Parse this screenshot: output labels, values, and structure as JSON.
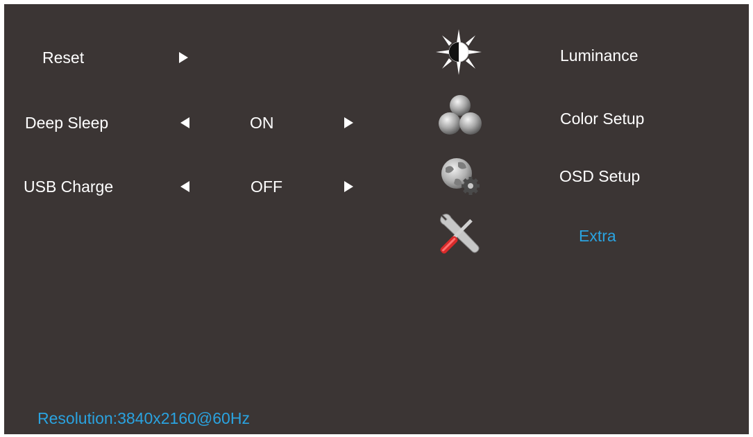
{
  "settings": {
    "rows": [
      {
        "label": "Reset"
      },
      {
        "label": "Deep Sleep",
        "value": "ON"
      },
      {
        "label": "USB Charge",
        "value": "OFF"
      }
    ]
  },
  "menu": {
    "items": [
      {
        "label": "Luminance",
        "icon": "sun-contrast-icon"
      },
      {
        "label": "Color Setup",
        "icon": "color-balls-icon"
      },
      {
        "label": "OSD Setup",
        "icon": "globe-gear-icon"
      },
      {
        "label": "Extra",
        "icon": "tools-icon",
        "active": true
      }
    ]
  },
  "status": {
    "resolution": "Resolution:3840x2160@60Hz"
  },
  "colors": {
    "background": "#3b3534",
    "text": "#ffffff",
    "accent": "#2aa3e0"
  }
}
